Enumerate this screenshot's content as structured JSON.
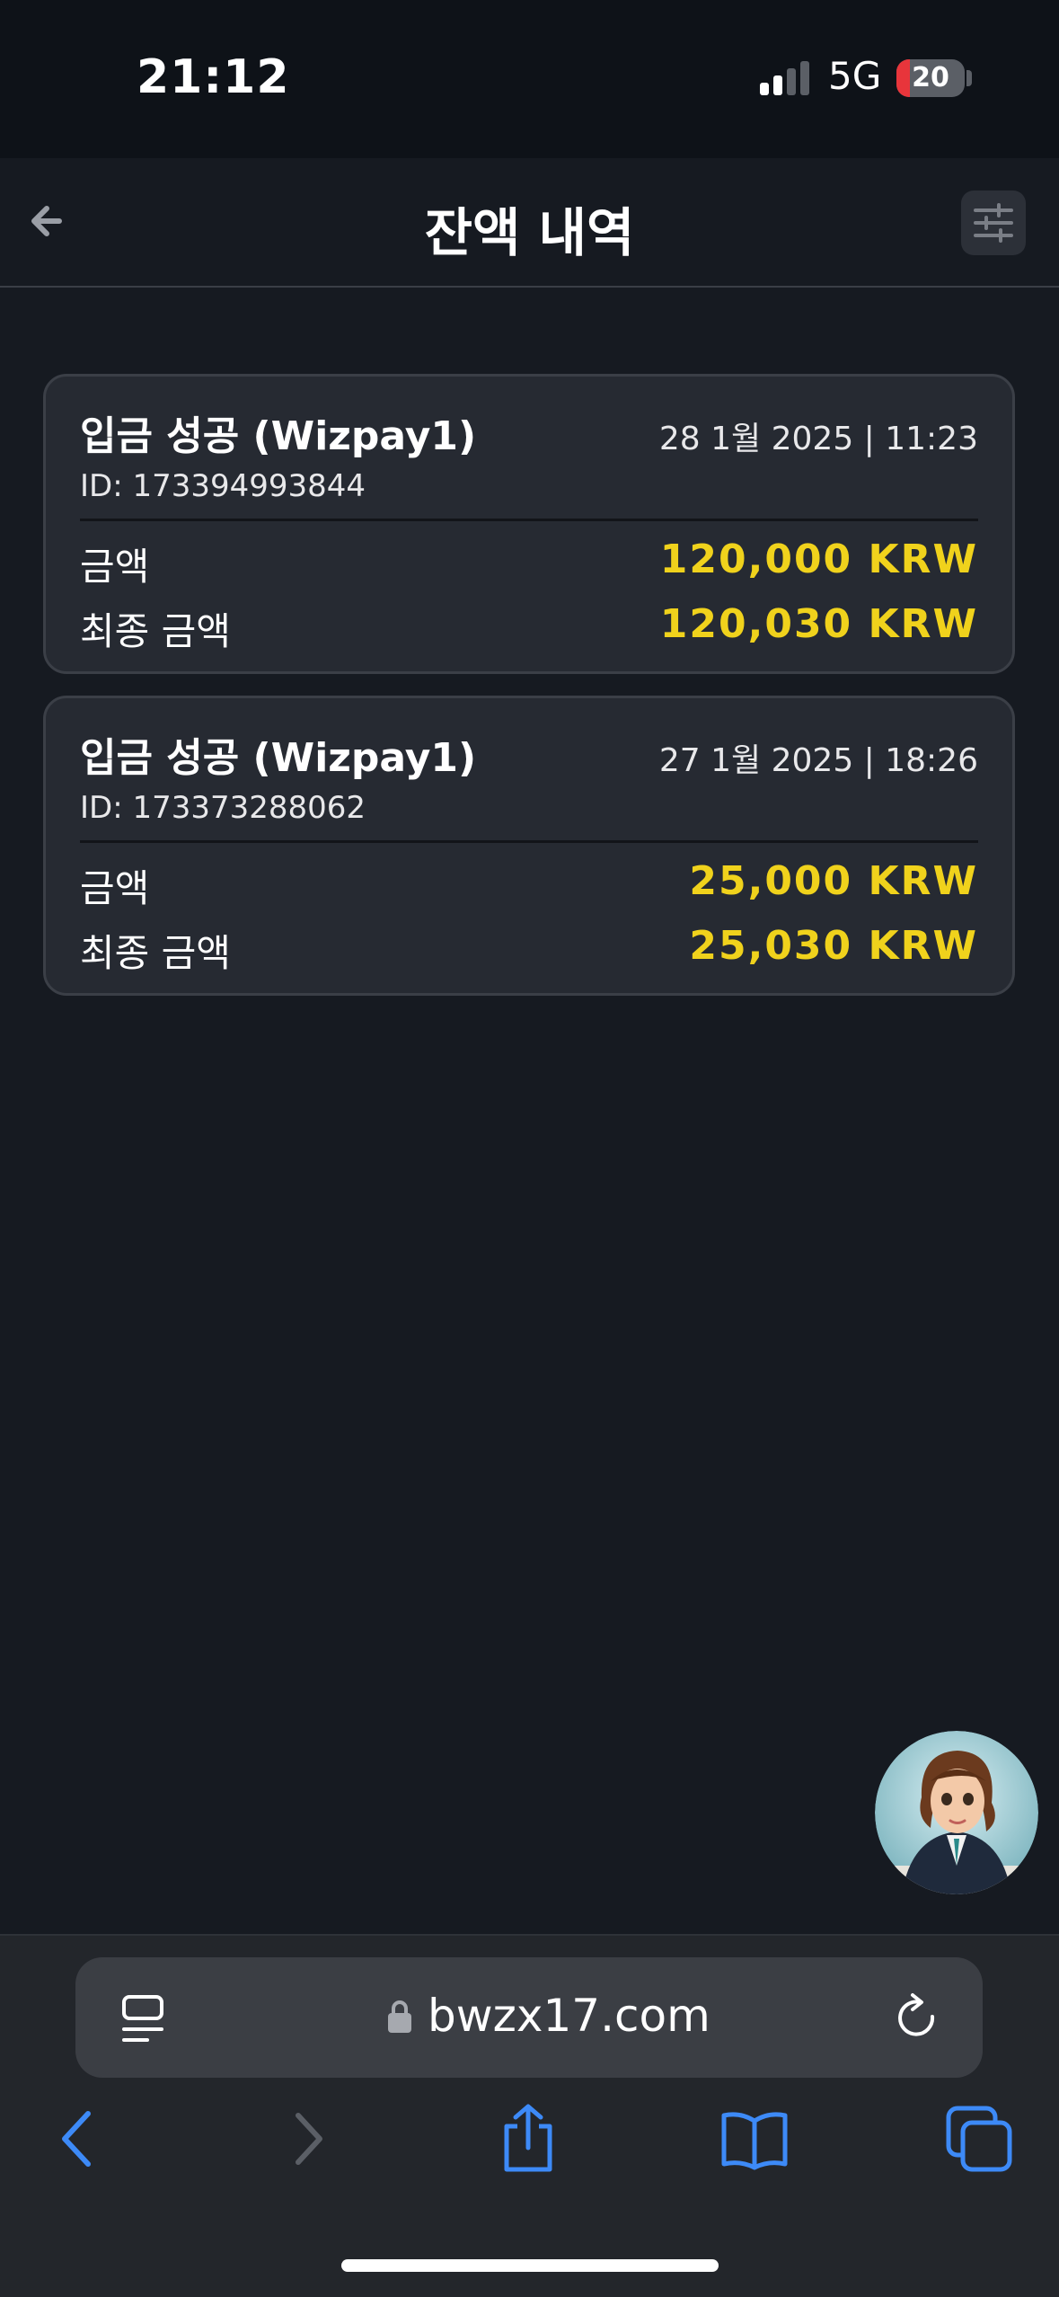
{
  "status_bar": {
    "time": "21:12",
    "network": "5G",
    "battery": "20",
    "battery_level": 0.2
  },
  "header": {
    "title": "잔액 내역",
    "back_icon": "arrow-left-icon",
    "filter_icon": "sliders-icon"
  },
  "transactions": [
    {
      "title": "입금 성공 (Wizpay1)",
      "date": "28 1월 2025 | 11:23",
      "id": "ID: 173394993844",
      "amount_label": "금액",
      "amount": "120,000 KRW",
      "final_label": "최종 금액",
      "final_amount": "120,030 KRW"
    },
    {
      "title": "입금 성공 (Wizpay1)",
      "date": "27 1월 2025 | 18:26",
      "id": "ID: 173373288062",
      "amount_label": "금액",
      "amount": "25,000 KRW",
      "final_label": "최종 금액",
      "final_amount": "25,030 KRW"
    }
  ],
  "browser": {
    "url": "bwzx17.com",
    "icons": [
      "tab-overview-icon",
      "lock-icon",
      "reload-icon",
      "back-icon",
      "forward-icon",
      "share-icon",
      "bookmarks-icon",
      "tabs-icon"
    ]
  },
  "colors": {
    "accent_amount": "#f0d21c",
    "link_blue": "#3d8af7",
    "background": "#161a21",
    "card": "#262a32"
  }
}
